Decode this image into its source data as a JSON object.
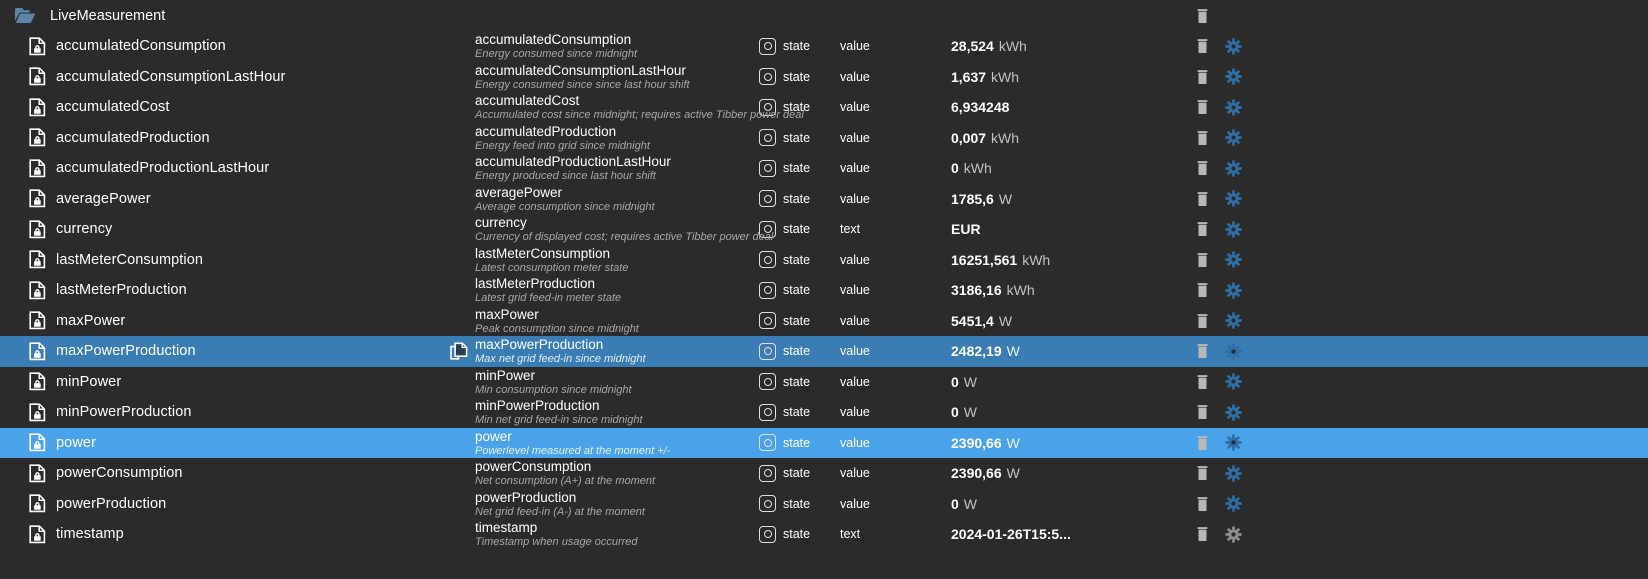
{
  "header": {
    "icon": "folder-open-icon",
    "title": "LiveMeasurement",
    "delete_icon": "trash-icon"
  },
  "columns": {
    "state_label": "state",
    "type_value": "value",
    "type_text": "text"
  },
  "icons": {
    "item": "document-lock-icon",
    "state": "state-circle-icon",
    "copy": "copy-icon",
    "delete": "trash-icon",
    "settings": "gear-icon"
  },
  "colors": {
    "background": "#2b2b2b",
    "selected_dark": "#3a7cb4",
    "selected_light": "#4aa3e8",
    "gear_blue": "#2f6ea5",
    "gear_gray": "#8d8d8d",
    "trash_gray": "#b8b8b8",
    "folder_blue": "#5a86ad",
    "description_gray": "#a8a8a8"
  },
  "rows": [
    {
      "name": "accumulatedConsumption",
      "mid_name": "accumulatedConsumption",
      "description": "Energy consumed since midnight",
      "state": "state",
      "type": "value",
      "value_num": "28,524",
      "value_unit": "kWh",
      "selected": "none",
      "has_copy": false,
      "gear_style": "blue"
    },
    {
      "name": "accumulatedConsumptionLastHour",
      "mid_name": "accumulatedConsumptionLastHour",
      "description": "Energy consumed since since last hour shift",
      "state": "state",
      "type": "value",
      "value_num": "1,637",
      "value_unit": "kWh",
      "selected": "none",
      "has_copy": false,
      "gear_style": "blue"
    },
    {
      "name": "accumulatedCost",
      "mid_name": "accumulatedCost",
      "description": "Accumulated cost since midnight; requires active Tibber power deal",
      "state": "state",
      "type": "value",
      "value_num": "6,934248",
      "value_unit": "",
      "selected": "none",
      "has_copy": false,
      "gear_style": "blue"
    },
    {
      "name": "accumulatedProduction",
      "mid_name": "accumulatedProduction",
      "description": "Energy feed into grid since midnight",
      "state": "state",
      "type": "value",
      "value_num": "0,007",
      "value_unit": "kWh",
      "selected": "none",
      "has_copy": false,
      "gear_style": "blue"
    },
    {
      "name": "accumulatedProductionLastHour",
      "mid_name": "accumulatedProductionLastHour",
      "description": "Energy produced since last hour shift",
      "state": "state",
      "type": "value",
      "value_num": "0",
      "value_unit": "kWh",
      "selected": "none",
      "has_copy": false,
      "gear_style": "blue"
    },
    {
      "name": "averagePower",
      "mid_name": "averagePower",
      "description": "Average consumption since midnight",
      "state": "state",
      "type": "value",
      "value_num": "1785,6",
      "value_unit": "W",
      "selected": "none",
      "has_copy": false,
      "gear_style": "blue"
    },
    {
      "name": "currency",
      "mid_name": "currency",
      "description": "Currency of displayed cost; requires active Tibber power deal",
      "state": "state",
      "type": "text",
      "value_num": "EUR",
      "value_unit": "",
      "selected": "none",
      "has_copy": false,
      "gear_style": "blue"
    },
    {
      "name": "lastMeterConsumption",
      "mid_name": "lastMeterConsumption",
      "description": "Latest consumption meter state",
      "state": "state",
      "type": "value",
      "value_num": "16251,561",
      "value_unit": "kWh",
      "selected": "none",
      "has_copy": false,
      "gear_style": "blue"
    },
    {
      "name": "lastMeterProduction",
      "mid_name": "lastMeterProduction",
      "description": "Latest grid feed-in meter state",
      "state": "state",
      "type": "value",
      "value_num": "3186,16",
      "value_unit": "kWh",
      "selected": "none",
      "has_copy": false,
      "gear_style": "blue"
    },
    {
      "name": "maxPower",
      "mid_name": "maxPower",
      "description": "Peak consumption since midnight",
      "state": "state",
      "type": "value",
      "value_num": "5451,4",
      "value_unit": "W",
      "selected": "none",
      "has_copy": false,
      "gear_style": "blue"
    },
    {
      "name": "maxPowerProduction",
      "mid_name": "maxPowerProduction",
      "description": "Max net grid feed-in since midnight",
      "state": "state",
      "type": "value",
      "value_num": "2482,19",
      "value_unit": "W",
      "selected": "dark",
      "has_copy": true,
      "gear_style": "blue"
    },
    {
      "name": "minPower",
      "mid_name": "minPower",
      "description": "Min consumption since midnight",
      "state": "state",
      "type": "value",
      "value_num": "0",
      "value_unit": "W",
      "selected": "none",
      "has_copy": false,
      "gear_style": "blue"
    },
    {
      "name": "minPowerProduction",
      "mid_name": "minPowerProduction",
      "description": "Min net grid feed-in since midnight",
      "state": "state",
      "type": "value",
      "value_num": "0",
      "value_unit": "W",
      "selected": "none",
      "has_copy": false,
      "gear_style": "blue"
    },
    {
      "name": "power",
      "mid_name": "power",
      "description": "Powerlevel measured at the moment +/-",
      "state": "state",
      "type": "value",
      "value_num": "2390,66",
      "value_unit": "W",
      "selected": "light",
      "has_copy": false,
      "gear_style": "blue"
    },
    {
      "name": "powerConsumption",
      "mid_name": "powerConsumption",
      "description": "Net consumption (A+) at the moment",
      "state": "state",
      "type": "value",
      "value_num": "2390,66",
      "value_unit": "W",
      "selected": "none",
      "has_copy": false,
      "gear_style": "blue"
    },
    {
      "name": "powerProduction",
      "mid_name": "powerProduction",
      "description": "Net grid feed-in (A-) at the moment",
      "state": "state",
      "type": "value",
      "value_num": "0",
      "value_unit": "W",
      "selected": "none",
      "has_copy": false,
      "gear_style": "blue"
    },
    {
      "name": "timestamp",
      "mid_name": "timestamp",
      "description": "Timestamp when usage occurred",
      "state": "state",
      "type": "text",
      "value_num": "2024-01-26T15:5...",
      "value_unit": "",
      "selected": "none",
      "has_copy": false,
      "gear_style": "gray"
    }
  ]
}
